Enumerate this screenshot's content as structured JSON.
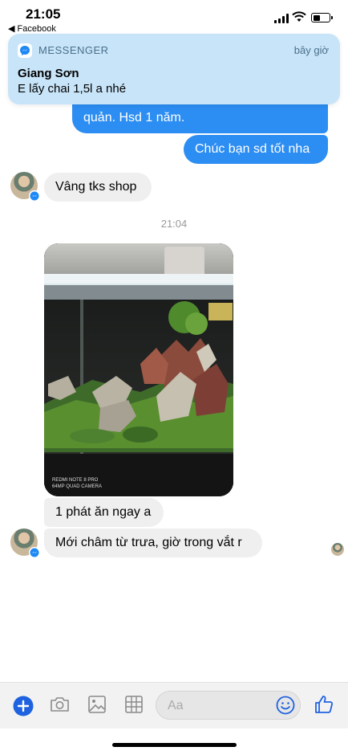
{
  "status_bar": {
    "time": "21:05",
    "back_app": "◀ Facebook"
  },
  "notification": {
    "app": "MESSENGER",
    "time": "bây giờ",
    "sender": "Giang Sơn",
    "body": "E lấy chai 1,5l a nhé"
  },
  "messages": {
    "out_1_partial": "quản. Hsd 1 năm.",
    "out_2": "Chúc bạn sd tốt nha",
    "in_1": "Vâng tks shop",
    "timestamp": "21:04",
    "photo_watermark_line1": "REDMI NOTE 8 PRO",
    "photo_watermark_line2": "64MP QUAD CAMERA",
    "in_2": "1 phát ăn ngay a",
    "in_3": "Mới châm từ trưa, giờ trong vắt r"
  },
  "composer": {
    "placeholder": "Aa"
  },
  "colors": {
    "accent": "#2c8df2",
    "notification_bg": "#c8e4f8",
    "bubble_in": "#efefef"
  },
  "icons": [
    "plus-icon",
    "camera-icon",
    "gallery-icon",
    "more-apps-icon",
    "emoji-icon",
    "like-icon"
  ]
}
